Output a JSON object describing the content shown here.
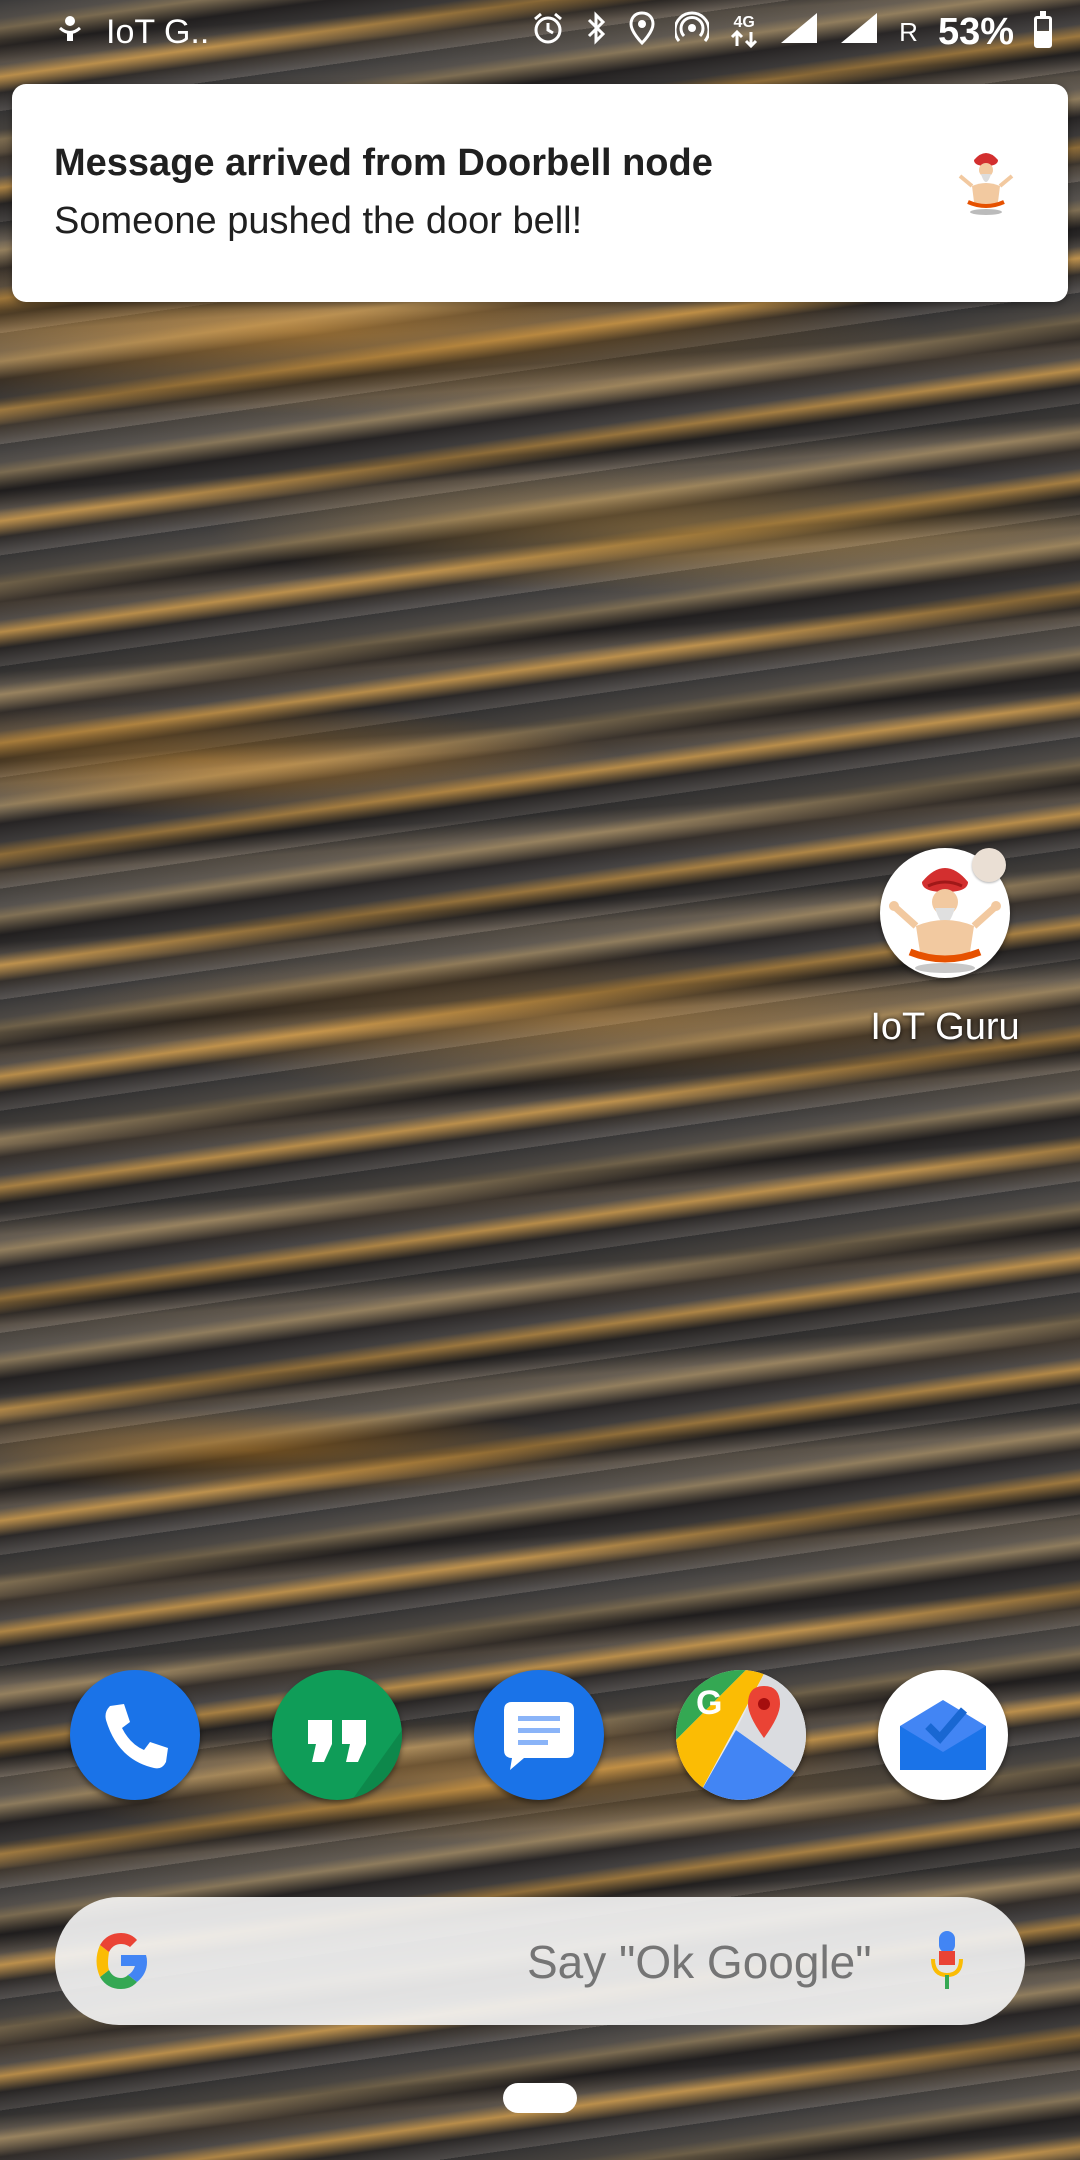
{
  "status_bar": {
    "app_name": "IoT G..",
    "battery_percent": "53%",
    "battery_level": 0.53,
    "roaming_label": "R",
    "network_label": "4G",
    "icons": [
      "notification-app-icon",
      "alarm-icon",
      "bluetooth-icon",
      "location-icon",
      "hotspot-icon",
      "4g-data-icon",
      "signal-icon",
      "signal-roaming-icon",
      "battery-icon"
    ]
  },
  "notification": {
    "title": "Message arrived from Doorbell node",
    "text": "Someone pushed the door bell!",
    "icon": "iot-guru-logo-icon"
  },
  "home_app": {
    "label": "IoT Guru",
    "icon": "iot-guru-logo-icon",
    "has_notification_dot": true
  },
  "dock": {
    "apps": [
      {
        "name": "Phone",
        "icon": "phone-icon",
        "color": "#1a73e8"
      },
      {
        "name": "Hangouts",
        "icon": "hangouts-icon",
        "color": "#0f9d58"
      },
      {
        "name": "Messages",
        "icon": "messages-icon",
        "color": "#1a73e8"
      },
      {
        "name": "Maps",
        "icon": "maps-icon",
        "color": "#34a853"
      },
      {
        "name": "Inbox",
        "icon": "inbox-icon",
        "color": "#4285f4"
      }
    ]
  },
  "search": {
    "placeholder": "Say \"Ok Google\"",
    "logo": "google-g-icon",
    "mic": "mic-icon"
  }
}
